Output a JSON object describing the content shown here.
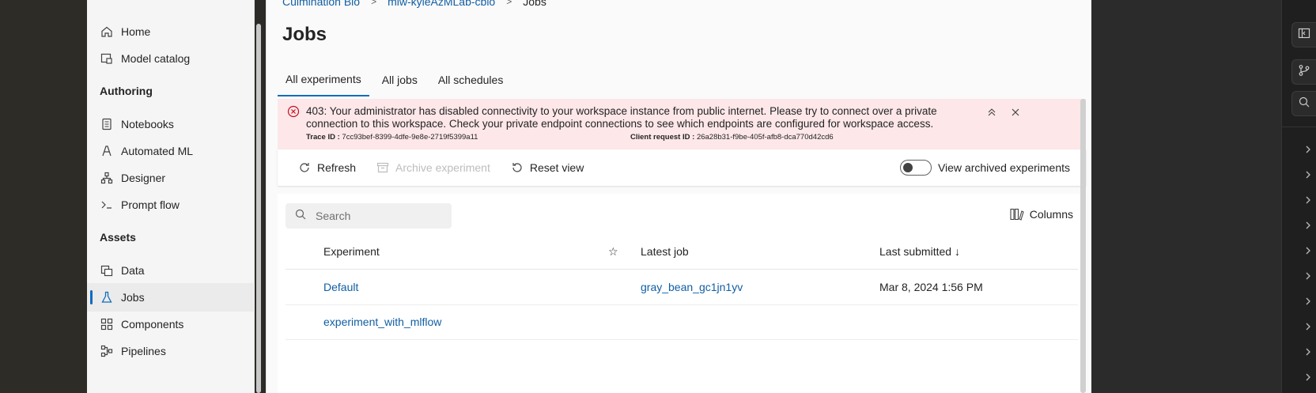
{
  "sidebar": {
    "items": [
      {
        "label": "Home",
        "icon": "home-icon"
      },
      {
        "label": "Model catalog",
        "icon": "model-catalog-icon"
      },
      {
        "label": "Notebooks",
        "icon": "notebook-icon"
      },
      {
        "label": "Automated ML",
        "icon": "automated-ml-icon"
      },
      {
        "label": "Designer",
        "icon": "designer-icon"
      },
      {
        "label": "Prompt flow",
        "icon": "prompt-flow-icon"
      },
      {
        "label": "Data",
        "icon": "data-icon"
      },
      {
        "label": "Jobs",
        "icon": "jobs-icon"
      },
      {
        "label": "Components",
        "icon": "components-icon"
      },
      {
        "label": "Pipelines",
        "icon": "pipelines-icon"
      }
    ],
    "sections": {
      "authoring": "Authoring",
      "assets": "Assets"
    },
    "active": "Jobs"
  },
  "breadcrumb": {
    "items": [
      "Culmination Bio",
      "mlw-kyleAzMLab-cbio",
      "Jobs"
    ]
  },
  "page": {
    "title": "Jobs"
  },
  "tabs": [
    {
      "label": "All experiments",
      "active": true
    },
    {
      "label": "All jobs",
      "active": false
    },
    {
      "label": "All schedules",
      "active": false
    }
  ],
  "alert": {
    "message": "403: Your administrator has disabled connectivity to your workspace instance from public internet. Please try to connect over a private connection to this workspace. Check your private endpoint connections to see which endpoints are configured for workspace access.",
    "trace_label": "Trace ID :",
    "trace_value": "7cc93bef-8399-4dfe-9e8e-2719f5399a11",
    "client_label": "Client request ID :",
    "client_value": "26a28b31-f9be-405f-afb8-dca770d42cd6"
  },
  "toolbar": {
    "refresh": "Refresh",
    "archive": "Archive experiment",
    "reset": "Reset view",
    "view_archived": "View archived experiments"
  },
  "search": {
    "placeholder": "Search"
  },
  "columns_label": "Columns",
  "table": {
    "headers": {
      "experiment": "Experiment",
      "latest_job": "Latest job",
      "last_submitted": "Last submitted ↓"
    },
    "rows": [
      {
        "experiment": "Default",
        "latest_job": "gray_bean_gc1jn1yv",
        "last_submitted": "Mar 8, 2024 1:56 PM"
      },
      {
        "experiment": "experiment_with_mlflow",
        "latest_job": "",
        "last_submitted": ""
      }
    ]
  },
  "colors": {
    "accent": "#0f6cbd",
    "link": "#115ea3",
    "error_bg": "#fde7e9",
    "error_icon": "#c50f1f"
  }
}
